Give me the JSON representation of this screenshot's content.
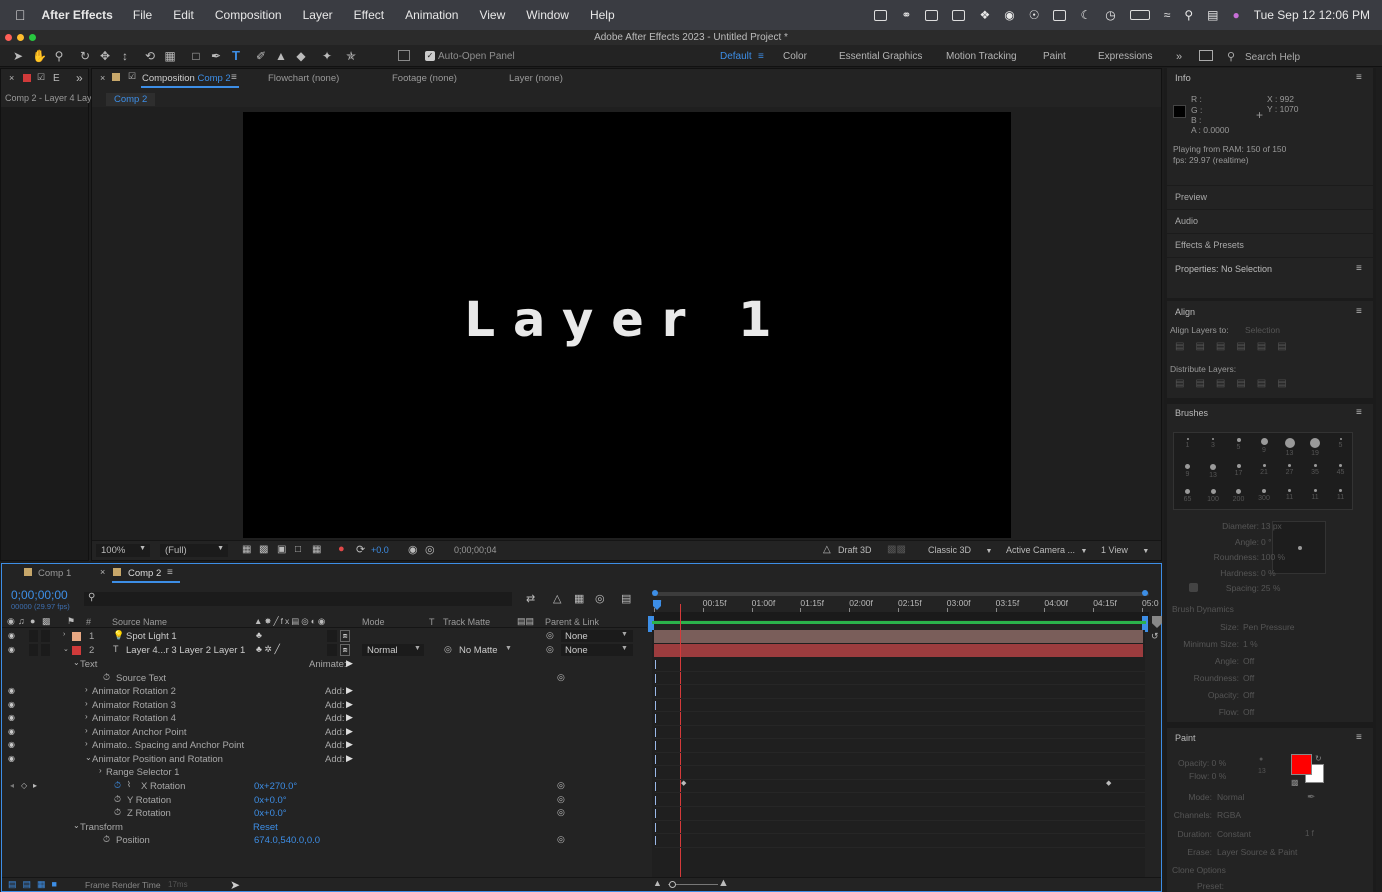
{
  "menubar": {
    "app_name": "After Effects",
    "menus": [
      "File",
      "Edit",
      "Composition",
      "Layer",
      "Effect",
      "Animation",
      "View",
      "Window",
      "Help"
    ],
    "datetime": "Tue Sep 12  12:06 PM"
  },
  "window": {
    "title": "Adobe After Effects 2023 - Untitled Project *"
  },
  "toolbar": {
    "auto_open_label": "Auto-Open Panel",
    "workspaces": [
      "Default",
      "Color",
      "Essential Graphics",
      "Motion Tracking",
      "Paint",
      "Expressions"
    ],
    "active_workspace": "Default",
    "search_placeholder": "Search Help"
  },
  "project_panel": {
    "tab_label": "E",
    "item_label": "Comp 2 - Layer 4 Lay"
  },
  "viewer": {
    "tabs": {
      "composition_prefix": "Composition",
      "composition_name": "Comp 2",
      "flowchart": "Flowchart (none)",
      "footage": "Footage (none)",
      "layer": "Layer (none)"
    },
    "breadcrumb": "Comp 2",
    "canvas_text": "Layer 1",
    "footer": {
      "zoom": "100%",
      "resolution": "(Full)",
      "exposure": "+0.0",
      "timecode": "0;00;00;04",
      "renderer": "Draft 3D",
      "render_mode": "Classic 3D",
      "camera": "Active Camera ...",
      "views": "1 View"
    }
  },
  "info_panel": {
    "title": "Info",
    "r": "R :",
    "g": "G :",
    "b": "B :",
    "a": "A :  0.0000",
    "x": "X : 992",
    "y": "Y : 1070",
    "line1": "Playing from RAM: 150 of 150",
    "line2": "fps: 29.97 (realtime)"
  },
  "side_panels": {
    "preview": "Preview",
    "audio": "Audio",
    "effects": "Effects & Presets",
    "properties": "Properties: No Selection",
    "align": "Align",
    "align_to_label": "Align Layers to:",
    "align_to_value": "Selection",
    "distribute": "Distribute Layers:",
    "brushes": "Brushes",
    "brush_sizes": [
      "1",
      "3",
      "5",
      "9",
      "13",
      "19",
      "5",
      "9",
      "13",
      "17",
      "21",
      "27",
      "35",
      "45",
      "65",
      "100",
      "200",
      "300",
      "11",
      "11",
      "11"
    ],
    "brush_props": [
      {
        "label": "Diameter:",
        "value": "13 px"
      },
      {
        "label": "Angle:",
        "value": "0 °"
      },
      {
        "label": "Roundness:",
        "value": "100 %"
      },
      {
        "label": "Hardness:",
        "value": "0 %"
      },
      {
        "label": "Spacing:",
        "value": "25 %"
      }
    ],
    "brush_dynamics": "Brush Dynamics",
    "dynamics": [
      {
        "label": "Size:",
        "value": "Pen Pressure"
      },
      {
        "label": "Minimum Size:",
        "value": "1 %"
      },
      {
        "label": "Angle:",
        "value": "Off"
      },
      {
        "label": "Roundness:",
        "value": "Off"
      },
      {
        "label": "Opacity:",
        "value": "Off"
      },
      {
        "label": "Flow:",
        "value": "Off"
      }
    ],
    "paint": "Paint",
    "paint_opacity": "Opacity:  0 %",
    "paint_flow": "Flow:  0 %",
    "paint_flow_num": "13",
    "paint_props": [
      {
        "label": "Mode:",
        "value": "Normal"
      },
      {
        "label": "Channels:",
        "value": "RGBA"
      },
      {
        "label": "Duration:",
        "value": "Constant"
      },
      {
        "label": "Erase:",
        "value": "Layer Source & Paint"
      }
    ],
    "paint_duration_frames": "1 f",
    "clone_options": "Clone Options",
    "preset": "Preset:",
    "fg_color": "#ff0000",
    "bg_color": "#ffffff"
  },
  "timeline": {
    "tabs": [
      "Comp 1",
      "Comp 2"
    ],
    "timecode": "0;00;00;00",
    "timecode_sub": "00000 (29.97 fps)",
    "headers": {
      "num": "#",
      "source": "Source Name",
      "mode": "Mode",
      "t": "T",
      "track_matte": "Track Matte",
      "parent": "Parent & Link"
    },
    "ruler": [
      "0f",
      "00:15f",
      "01:00f",
      "01:15f",
      "02:00f",
      "02:15f",
      "03:00f",
      "03:15f",
      "04:00f",
      "04:15f",
      "05:0"
    ],
    "layers": [
      {
        "num": "1",
        "name": "Spot Light 1",
        "parent": "None",
        "color": "#e8a883"
      },
      {
        "num": "2",
        "name": "Layer 4...r 3 Layer 2 Layer 1",
        "mode": "Normal",
        "matte": "No Matte",
        "parent": "None",
        "color": "#d03a3a"
      }
    ],
    "props": {
      "text": "Text",
      "animate": "Animate:",
      "source_text": "Source Text",
      "animators": [
        "Animator Rotation 2",
        "Animator Rotation 3",
        "Animator Rotation 4",
        "Animator Anchor Point",
        "Animato.. Spacing and Anchor Point",
        "Animator Position and Rotation"
      ],
      "add": "Add:",
      "range_selector": "Range Selector 1",
      "x_rotation": "X Rotation",
      "x_rotation_val": "0x+270.0°",
      "y_rotation": "Y Rotation",
      "y_rotation_val": "0x+0.0°",
      "z_rotation": "Z Rotation",
      "z_rotation_val": "0x+0.0°",
      "transform": "Transform",
      "reset": "Reset",
      "position": "Position",
      "position_val": "674.0,540.0,0.0"
    },
    "footer": {
      "render_time_label": "Frame Render Time",
      "render_time_value": "17ms"
    }
  }
}
